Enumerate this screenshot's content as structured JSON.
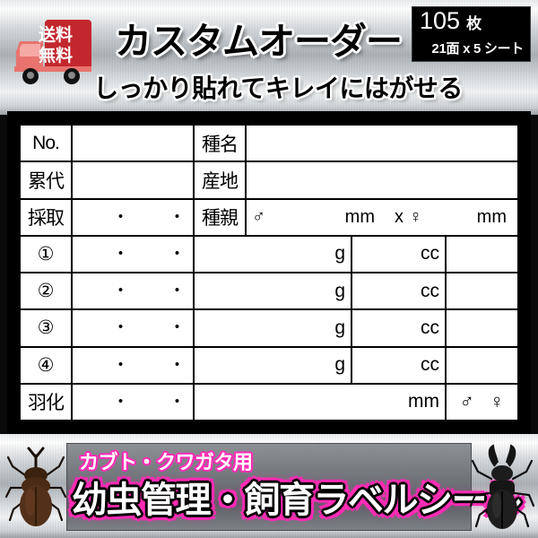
{
  "header": {
    "title_main": "カスタムオーダー",
    "title_sub": "しっかり貼れてキレイにはがせる",
    "shipping_badge": {
      "icon": "delivery-truck-icon",
      "line1": "送料",
      "line2": "無料"
    },
    "quantity_badge": {
      "number": "105",
      "unit": "枚",
      "detail": "21面 x 5 シート"
    }
  },
  "label_table": {
    "rows": [
      {
        "id": "row-no",
        "label": "No.",
        "cells": [
          "",
          "種名",
          ""
        ]
      },
      {
        "id": "row-ruidai",
        "label": "累代",
        "cells": [
          "",
          "産地",
          ""
        ]
      },
      {
        "id": "row-saishu",
        "label": "採取",
        "date_dots": [
          "・",
          "・"
        ],
        "cells": [
          "種親"
        ],
        "male_symbol": "♂",
        "male_unit": "mm",
        "times": "x",
        "female_symbol": "♀",
        "female_unit": "mm"
      },
      {
        "id": "row-1",
        "label": "①",
        "date_dots": [
          "・",
          "・"
        ],
        "weight_unit": "g",
        "volume_unit": "cc",
        "note": ""
      },
      {
        "id": "row-2",
        "label": "②",
        "date_dots": [
          "・",
          "・"
        ],
        "weight_unit": "g",
        "volume_unit": "cc",
        "note": ""
      },
      {
        "id": "row-3",
        "label": "③",
        "date_dots": [
          "・",
          "・"
        ],
        "weight_unit": "g",
        "volume_unit": "cc",
        "note": ""
      },
      {
        "id": "row-4",
        "label": "④",
        "date_dots": [
          "・",
          "・"
        ],
        "weight_unit": "g",
        "volume_unit": "cc",
        "note": ""
      },
      {
        "id": "row-uka",
        "label": "羽化",
        "date_dots": [
          "・",
          "・"
        ],
        "size_unit": "mm",
        "male_symbol": "♂",
        "female_symbol": "♀"
      }
    ]
  },
  "footer": {
    "subtitle": "カブト・クワガタ用",
    "title": "幼虫管理・飼育ラベルシール",
    "beetle_left": "rhinoceros-beetle-icon",
    "beetle_right": "stag-beetle-icon"
  },
  "colors": {
    "accent_pink": "#ff2bb5",
    "shipping_red": "#c2272d",
    "badge_black": "#000000",
    "frame_black": "#000000"
  }
}
